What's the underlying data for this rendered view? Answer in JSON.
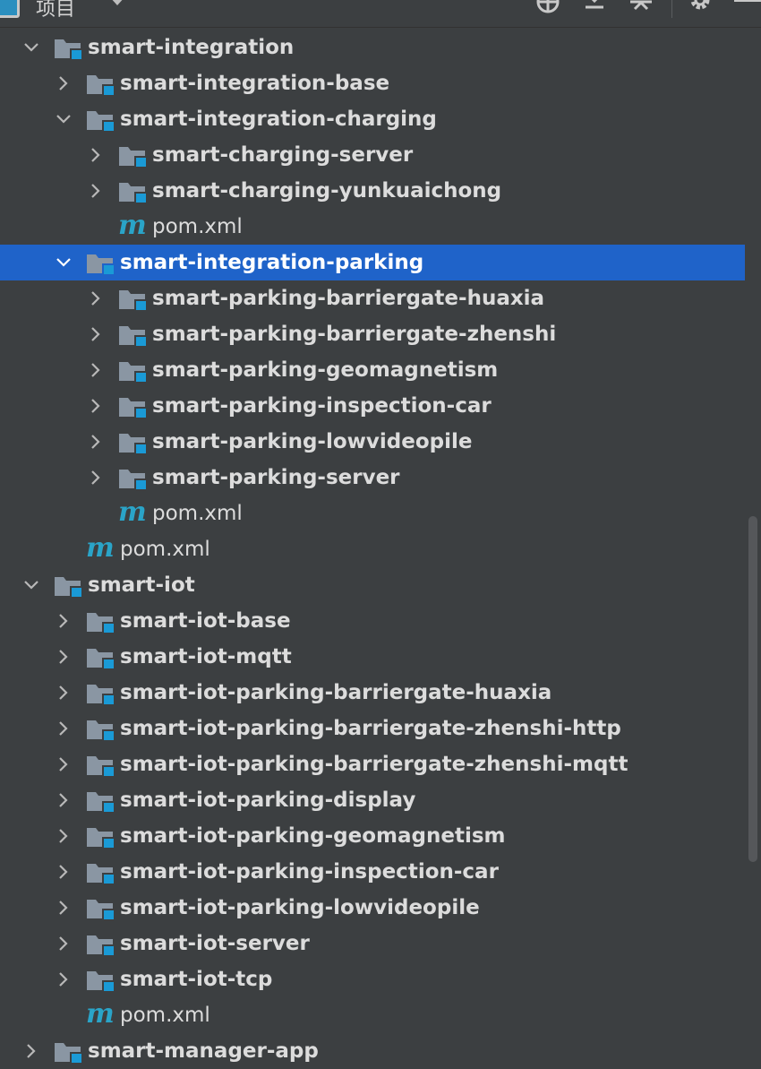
{
  "toolbar": {
    "title": "项目",
    "icons": [
      "target-icon",
      "expand-all-icon",
      "collapse-all-icon",
      "gear-icon"
    ]
  },
  "colors": {
    "background": "#3c3f41",
    "selection": "#1f63c9",
    "module_badge": "#1a9ad6",
    "maven": "#2aa4c8"
  },
  "tree": [
    {
      "label": "smart-integration",
      "type": "module",
      "expanded": true,
      "level": 1
    },
    {
      "label": "smart-integration-base",
      "type": "module",
      "expanded": false,
      "level": 2
    },
    {
      "label": "smart-integration-charging",
      "type": "module",
      "expanded": true,
      "level": 2
    },
    {
      "label": "smart-charging-server",
      "type": "module",
      "expanded": false,
      "level": 3
    },
    {
      "label": "smart-charging-yunkuaichong",
      "type": "module",
      "expanded": false,
      "level": 3
    },
    {
      "label": "pom.xml",
      "type": "pom",
      "level": 3
    },
    {
      "label": "smart-integration-parking",
      "type": "module",
      "expanded": true,
      "level": 2,
      "selected": true
    },
    {
      "label": "smart-parking-barriergate-huaxia",
      "type": "module",
      "expanded": false,
      "level": 3
    },
    {
      "label": "smart-parking-barriergate-zhenshi",
      "type": "module",
      "expanded": false,
      "level": 3
    },
    {
      "label": "smart-parking-geomagnetism",
      "type": "module",
      "expanded": false,
      "level": 3
    },
    {
      "label": "smart-parking-inspection-car",
      "type": "module",
      "expanded": false,
      "level": 3
    },
    {
      "label": "smart-parking-lowvideopile",
      "type": "module",
      "expanded": false,
      "level": 3
    },
    {
      "label": "smart-parking-server",
      "type": "module",
      "expanded": false,
      "level": 3
    },
    {
      "label": "pom.xml",
      "type": "pom",
      "level": 3
    },
    {
      "label": "pom.xml",
      "type": "pom",
      "level": 2
    },
    {
      "label": "smart-iot",
      "type": "module",
      "expanded": true,
      "level": 1
    },
    {
      "label": "smart-iot-base",
      "type": "module",
      "expanded": false,
      "level": 2
    },
    {
      "label": "smart-iot-mqtt",
      "type": "module",
      "expanded": false,
      "level": 2
    },
    {
      "label": "smart-iot-parking-barriergate-huaxia",
      "type": "module",
      "expanded": false,
      "level": 2
    },
    {
      "label": "smart-iot-parking-barriergate-zhenshi-http",
      "type": "module",
      "expanded": false,
      "level": 2
    },
    {
      "label": "smart-iot-parking-barriergate-zhenshi-mqtt",
      "type": "module",
      "expanded": false,
      "level": 2
    },
    {
      "label": "smart-iot-parking-display",
      "type": "module",
      "expanded": false,
      "level": 2
    },
    {
      "label": "smart-iot-parking-geomagnetism",
      "type": "module",
      "expanded": false,
      "level": 2
    },
    {
      "label": "smart-iot-parking-inspection-car",
      "type": "module",
      "expanded": false,
      "level": 2
    },
    {
      "label": "smart-iot-parking-lowvideopile",
      "type": "module",
      "expanded": false,
      "level": 2
    },
    {
      "label": "smart-iot-server",
      "type": "module",
      "expanded": false,
      "level": 2
    },
    {
      "label": "smart-iot-tcp",
      "type": "module",
      "expanded": false,
      "level": 2
    },
    {
      "label": "pom.xml",
      "type": "pom",
      "level": 2
    },
    {
      "label": "smart-manager-app",
      "type": "module",
      "expanded": false,
      "level": 1
    }
  ]
}
